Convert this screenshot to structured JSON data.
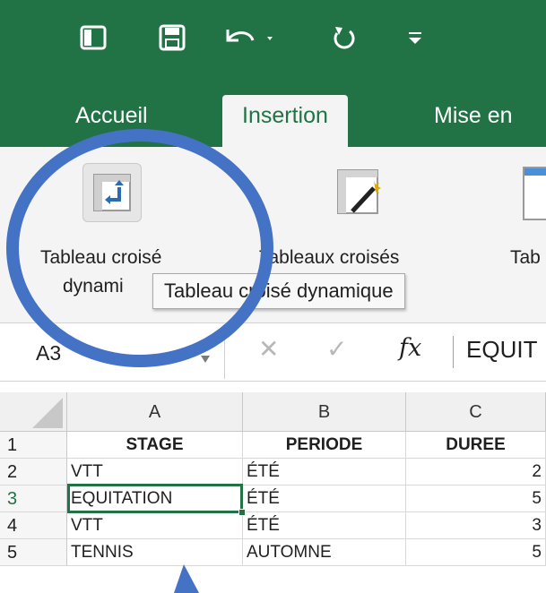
{
  "quick_access": [
    "sidebar-toggle-icon",
    "save-icon",
    "undo-icon",
    "redo-icon",
    "customize-icon"
  ],
  "tabs": [
    {
      "label": "Accueil"
    },
    {
      "label": "Insertion"
    },
    {
      "label": "Mise en"
    }
  ],
  "ribbon": {
    "pivot_table_label_1": "Tableau croisé",
    "pivot_table_label_2": "dynami",
    "recommended_label_1": "Tableaux croisés",
    "tables_label_1": "Tab",
    "tooltip": "Tableau croisé dynamique"
  },
  "formula_bar": {
    "name_box": "A3",
    "value": "EQUIT"
  },
  "columns": [
    "A",
    "B",
    "C"
  ],
  "rows": [
    {
      "num": "1",
      "a": "STAGE",
      "b": "PERIODE",
      "c": "DUREE"
    },
    {
      "num": "2",
      "a": "VTT",
      "b": "ÉTÉ",
      "c": "2"
    },
    {
      "num": "3",
      "a": "EQUITATION",
      "b": "ÉTÉ",
      "c": "5"
    },
    {
      "num": "4",
      "a": "VTT",
      "b": "ÉTÉ",
      "c": "3"
    },
    {
      "num": "5",
      "a": "TENNIS",
      "b": "AUTOMNE",
      "c": "5"
    }
  ],
  "colors": {
    "excel_green": "#217346",
    "annotation_blue": "#4472c4"
  }
}
